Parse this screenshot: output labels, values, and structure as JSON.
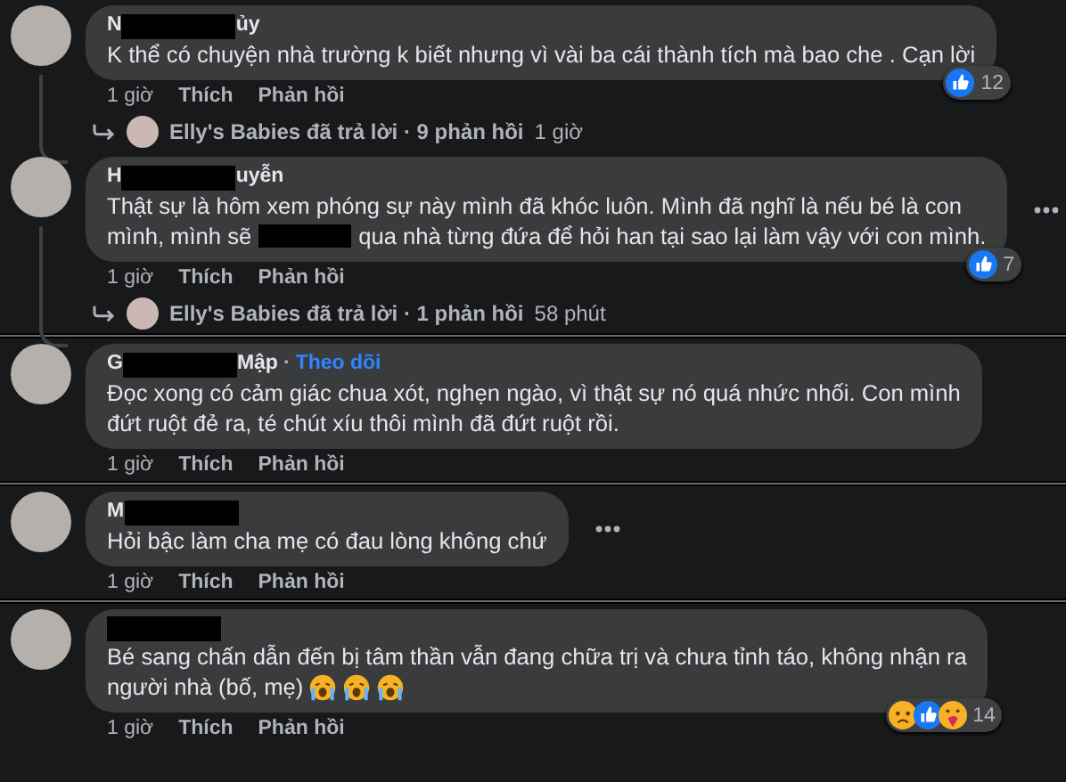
{
  "screenshots": [
    {
      "comments": [
        {
          "name": [
            {
              "kind": "text",
              "text": "N"
            },
            {
              "kind": "redaction"
            },
            {
              "kind": "text",
              "text": "ủy"
            }
          ],
          "lines": [
            [
              {
                "kind": "text",
                "text": "K thể có chuyện nhà trường k biết nhưng vì vài ba cái thành tích mà bao che . Cạn lời"
              }
            ]
          ],
          "reactions": {
            "icons": [
              {
                "kind": "like"
              }
            ],
            "count": "12"
          },
          "more_button": false,
          "meta": {
            "time": "1 giờ",
            "like": "Thích",
            "reply": "Phản hồi"
          },
          "reply_summary": {
            "text": "Elly's Babies đã trả lời · 9 phản hồi",
            "time": "1 giờ"
          }
        },
        {
          "name": [
            {
              "kind": "text",
              "text": "H"
            },
            {
              "kind": "redaction"
            },
            {
              "kind": "text",
              "text": "uyễn"
            }
          ],
          "lines": [
            [
              {
                "kind": "text",
                "text": "Thật sự là hôm xem phóng sự này mình đã khóc luôn. Mình đã nghĩ là nếu bé là con"
              }
            ],
            [
              {
                "kind": "text",
                "text": "mình, mình sẽ"
              },
              {
                "kind": "redaction"
              },
              {
                "kind": "text",
                "text": "qua nhà từng đứa để hỏi han tại sao lại làm vậy với con mình."
              }
            ]
          ],
          "reactions": {
            "icons": [
              {
                "kind": "like"
              }
            ],
            "count": "7"
          },
          "more_button": true,
          "meta": {
            "time": "1 giờ",
            "like": "Thích",
            "reply": "Phản hồi"
          },
          "reply_summary": {
            "text": "Elly's Babies đã trả lời · 1 phản hồi",
            "time": "58 phút"
          }
        }
      ]
    },
    {
      "comments": [
        {
          "name": [
            {
              "kind": "text",
              "text": "G"
            },
            {
              "kind": "redaction"
            },
            {
              "kind": "text",
              "text": "Mập"
            },
            {
              "kind": "separator",
              "text": "·"
            },
            {
              "kind": "link",
              "text": "Theo dõi"
            }
          ],
          "lines": [
            [
              {
                "kind": "text",
                "text": "Đọc xong có cảm giác chua xót, nghẹn ngào, vì thật sự nó quá nhức nhối. Con mình"
              }
            ],
            [
              {
                "kind": "text",
                "text": "đứt ruột đẻ ra, té chút xíu thôi mình đã đứt ruột rồi."
              }
            ]
          ],
          "more_button": false,
          "meta": {
            "time": "1 giờ",
            "like": "Thích",
            "reply": "Phản hồi"
          }
        }
      ]
    },
    {
      "comments": [
        {
          "name": [
            {
              "kind": "text",
              "text": "M"
            },
            {
              "kind": "redaction"
            }
          ],
          "lines": [
            [
              {
                "kind": "text",
                "text": "Hỏi bậc làm cha mẹ có đau lòng không chứ"
              }
            ]
          ],
          "more_button": true,
          "meta": {
            "time": "1 giờ",
            "like": "Thích",
            "reply": "Phản hồi"
          }
        }
      ]
    },
    {
      "comments": [
        {
          "name": [
            {
              "kind": "redaction"
            }
          ],
          "lines": [
            [
              {
                "kind": "text",
                "text": "Bé sang chấn dẫn đến bị tâm thần vẫn đang chữa trị và chưa tỉnh táo, không nhận ra"
              }
            ],
            [
              {
                "kind": "text",
                "text": "người nhà (bố, mẹ)"
              },
              {
                "kind": "crying"
              },
              {
                "kind": "crying"
              },
              {
                "kind": "crying"
              }
            ]
          ],
          "reactions": {
            "icons": [
              {
                "kind": "sad"
              },
              {
                "kind": "like"
              },
              {
                "kind": "care"
              }
            ],
            "count": "14"
          },
          "more_button": false,
          "meta": {
            "time": "1 giờ",
            "like": "Thích",
            "reply": "Phản hồi"
          }
        }
      ]
    }
  ]
}
